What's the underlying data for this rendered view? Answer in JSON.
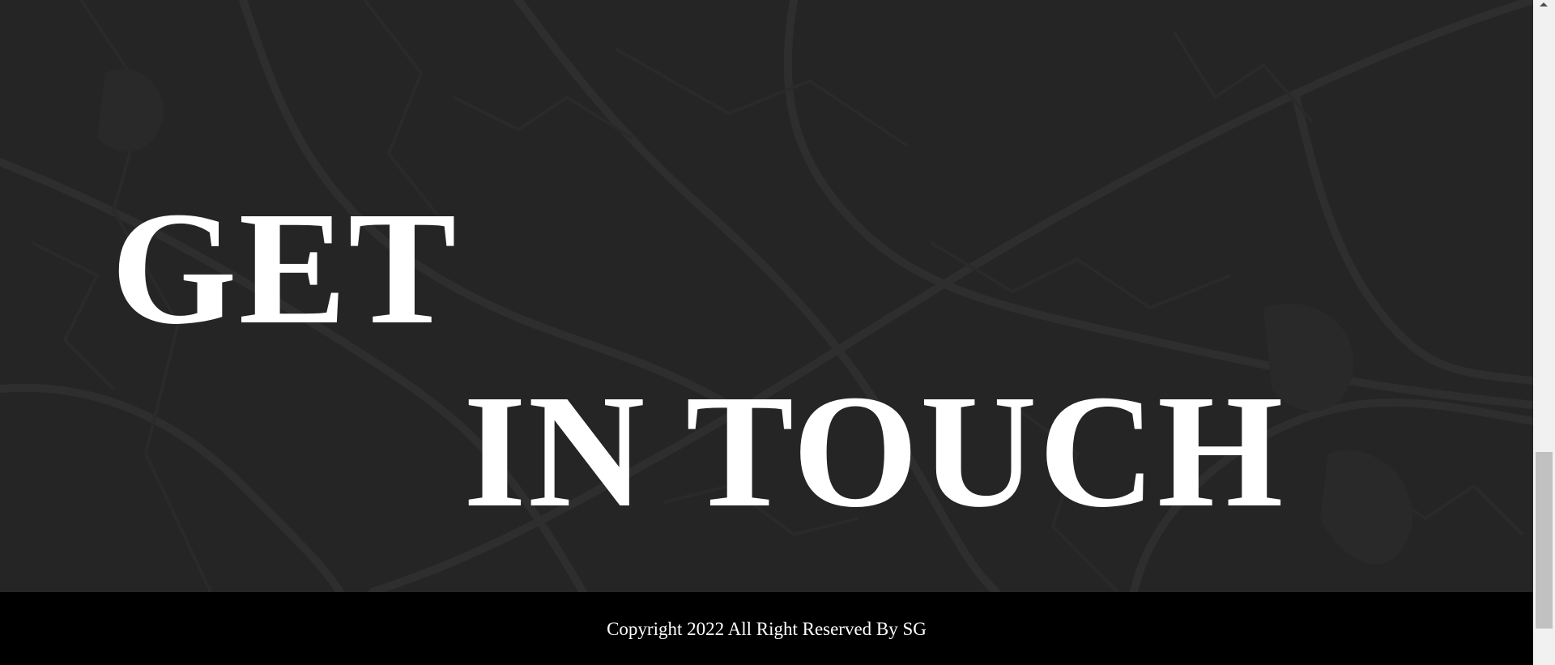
{
  "hero": {
    "line1": "GET",
    "line2": "IN TOUCH",
    "background_color": "#252525",
    "text_color": "#ffffff"
  },
  "footer": {
    "copyright": "Copyright 2022 All Right Reserved By SG",
    "background_color": "#000000"
  },
  "scrollbar": {
    "track_color": "#f1f1f1",
    "thumb_color": "#c1c1c1"
  }
}
